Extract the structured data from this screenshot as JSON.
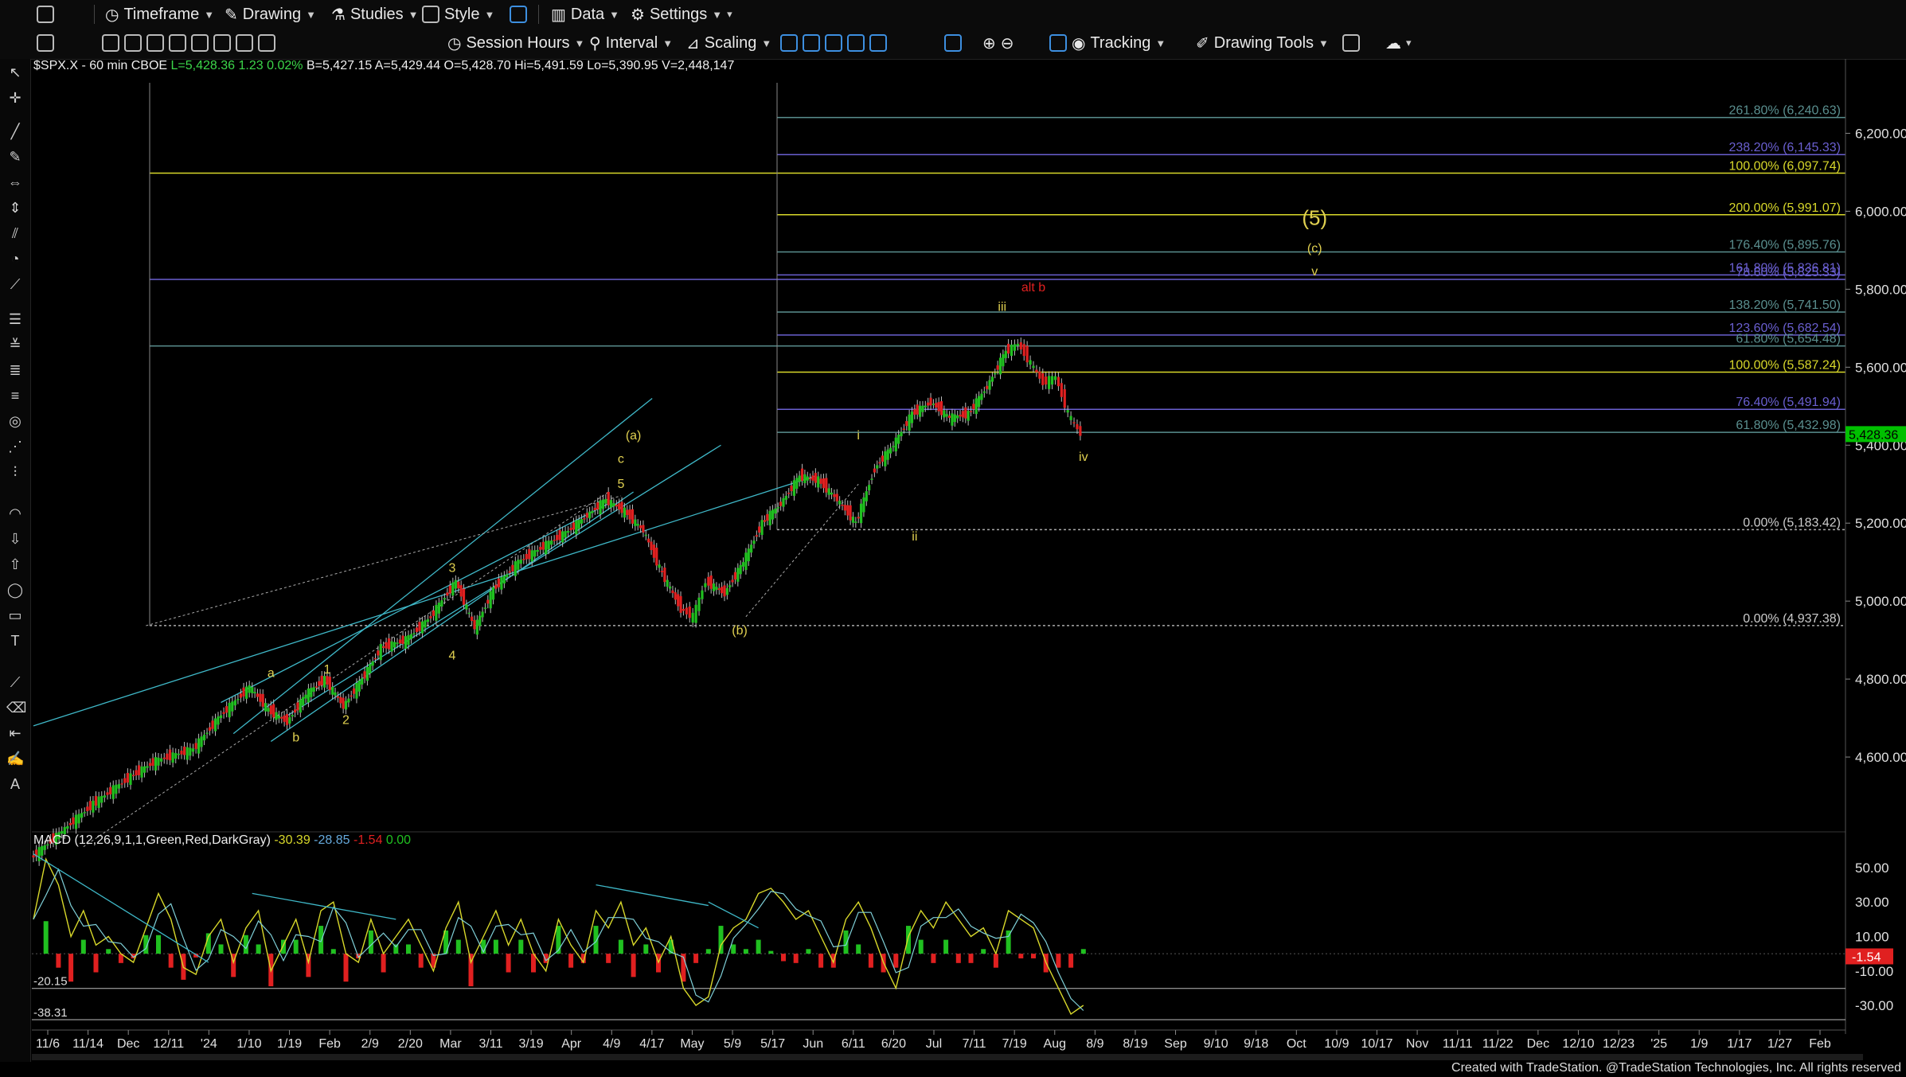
{
  "toolbar1": {
    "items": [
      {
        "name": "timeframe-menu",
        "label": "Timeframe",
        "icon": "clock-icon"
      },
      {
        "name": "drawing-menu",
        "label": "Drawing",
        "icon": "pencil-icon"
      },
      {
        "name": "studies-menu",
        "label": "Studies",
        "icon": "flask-icon"
      },
      {
        "name": "style-menu",
        "label": "Style",
        "icon": "style-icon"
      },
      {
        "name": "data-menu",
        "label": "Data",
        "icon": "bars-icon"
      },
      {
        "name": "settings-menu",
        "label": "Settings",
        "icon": "gear-icon"
      }
    ]
  },
  "toolbar2": {
    "session_hours": "Session Hours",
    "interval": "Interval",
    "scaling": "Scaling",
    "tracking": "Tracking",
    "drawing_tools": "Drawing Tools"
  },
  "symbol_header": {
    "symbol": "$SPX.X - 60 min",
    "exchange": "CBOE",
    "last": "L=5,428.36",
    "change": "1.23",
    "pct": "0.02%",
    "bid": "B=5,427.15",
    "ask": "A=5,429.44",
    "open": "O=5,428.70",
    "high": "Hi=5,491.59",
    "low": "Lo=5,390.95",
    "volume": "V=2,448,147"
  },
  "macd_header": {
    "label": "MACD (12,26,9,1,1,Green,Red,DarkGray)",
    "v1": "-30.39",
    "v2": "-28.85",
    "v3": "-1.54",
    "v4": "0.00"
  },
  "footer": "Created with TradeStation. @TradeStation Technologies, Inc. All rights reserved",
  "colors": {
    "up": "#20c020",
    "down": "#e02020",
    "yellow_level": "#d8d82a",
    "blue_level": "#6a5fd0",
    "teal_level": "#5a8f8f",
    "price_tag": "#00c000",
    "wave_label": "#e0d050",
    "alt_label": "#e02020"
  },
  "chart_data": [
    {
      "type": "candlestick",
      "title": "$SPX.X - 60 min",
      "ylim": [
        4400,
        6350
      ],
      "y_ticks": [
        "6,200.00",
        "6,000.00",
        "5,800.00",
        "5,600.00",
        "5,400.00",
        "5,200.00",
        "5,000.00",
        "4,800.00",
        "4,600.00"
      ],
      "y_tick_values": [
        6200,
        6000,
        5800,
        5600,
        5400,
        5200,
        5000,
        4800,
        4600
      ],
      "x_ticks": [
        "11/6",
        "11/14",
        "Dec",
        "12/11",
        "'24",
        "1/10",
        "1/19",
        "Feb",
        "2/9",
        "2/20",
        "Mar",
        "3/11",
        "3/19",
        "Apr",
        "4/9",
        "4/17",
        "May",
        "5/9",
        "5/17",
        "Jun",
        "6/11",
        "6/20",
        "Jul",
        "7/11",
        "7/19",
        "Aug",
        "8/9",
        "8/19",
        "Sep",
        "9/10",
        "9/18",
        "Oct",
        "10/9",
        "10/17",
        "Nov",
        "11/11",
        "11/22",
        "Dec",
        "12/10",
        "12/23",
        "'25",
        "1/9",
        "1/17",
        "1/27",
        "Feb"
      ],
      "last_price": "5,428.36",
      "price_path": [
        [
          0,
          4340
        ],
        [
          5,
          4410
        ],
        [
          10,
          4480
        ],
        [
          16,
          4550
        ],
        [
          20,
          4590
        ],
        [
          26,
          4620
        ],
        [
          30,
          4700
        ],
        [
          35,
          4780
        ],
        [
          38,
          4720
        ],
        [
          41,
          4690
        ],
        [
          44,
          4760
        ],
        [
          47,
          4800
        ],
        [
          50,
          4730
        ],
        [
          53,
          4800
        ],
        [
          56,
          4880
        ],
        [
          60,
          4900
        ],
        [
          64,
          4960
        ],
        [
          68,
          5050
        ],
        [
          71,
          4930
        ],
        [
          74,
          5030
        ],
        [
          78,
          5100
        ],
        [
          82,
          5140
        ],
        [
          86,
          5180
        ],
        [
          89,
          5220
        ],
        [
          92,
          5260
        ],
        [
          95,
          5230
        ],
        [
          98,
          5180
        ],
        [
          101,
          5070
        ],
        [
          104,
          4980
        ],
        [
          106,
          4960
        ],
        [
          108,
          5050
        ],
        [
          111,
          5020
        ],
        [
          114,
          5100
        ],
        [
          117,
          5200
        ],
        [
          120,
          5250
        ],
        [
          123,
          5320
        ],
        [
          126,
          5310
        ],
        [
          129,
          5260
        ],
        [
          132,
          5200
        ],
        [
          135,
          5340
        ],
        [
          138,
          5400
        ],
        [
          141,
          5480
        ],
        [
          144,
          5510
        ],
        [
          147,
          5470
        ],
        [
          150,
          5480
        ],
        [
          153,
          5550
        ],
        [
          156,
          5640
        ],
        [
          158,
          5660
        ],
        [
          160,
          5610
        ],
        [
          162,
          5560
        ],
        [
          164,
          5575
        ],
        [
          166,
          5480
        ],
        [
          168,
          5428
        ]
      ],
      "fib_levels": [
        {
          "label": "261.80% (6,240.63)",
          "value": 6240.63,
          "color": "teal"
        },
        {
          "label": "238.20% (6,145.33)",
          "value": 6145.33,
          "color": "blue"
        },
        {
          "label": "100.00% (6,097.74)",
          "value": 6097.74,
          "color": "yellow"
        },
        {
          "label": "200.00% (5,991.07)",
          "value": 5991.07,
          "color": "yellow"
        },
        {
          "label": "176.40% (5,895.76)",
          "value": 5895.76,
          "color": "teal"
        },
        {
          "label": "161.80% (5,836.81)",
          "value": 5836.81,
          "color": "blue"
        },
        {
          "label": "78.60% (5,825.33)",
          "value": 5825.33,
          "color": "blue"
        },
        {
          "label": "138.20% (5,741.50)",
          "value": 5741.5,
          "color": "teal"
        },
        {
          "label": "123.60% (5,682.54)",
          "value": 5682.54,
          "color": "blue"
        },
        {
          "label": "61.80% (5,654.48)",
          "value": 5654.48,
          "color": "teal"
        },
        {
          "label": "100.00% (5,587.24)",
          "value": 5587.24,
          "color": "yellow"
        },
        {
          "label": "76.40% (5,491.94)",
          "value": 5491.94,
          "color": "blue"
        },
        {
          "label": "61.80% (5,432.98)",
          "value": 5432.98,
          "color": "teal"
        },
        {
          "label": "0.00% (5,183.42)",
          "value": 5183.42,
          "color": "white"
        },
        {
          "label": "0.00% (4,937.38)",
          "value": 4937.38,
          "color": "white"
        }
      ],
      "wave_labels": [
        {
          "text": "(5)",
          "x": 205,
          "y": 5965,
          "color": "yellow",
          "big": true
        },
        {
          "text": "(c)",
          "x": 205,
          "y": 5895,
          "color": "yellow"
        },
        {
          "text": "v",
          "x": 205,
          "y": 5835,
          "color": "yellow"
        },
        {
          "text": "alt b",
          "x": 160,
          "y": 5795,
          "color": "red"
        },
        {
          "text": "iii",
          "x": 155,
          "y": 5745,
          "color": "yellow"
        },
        {
          "text": "i",
          "x": 132,
          "y": 5415,
          "color": "yellow"
        },
        {
          "text": "ii",
          "x": 141,
          "y": 5155,
          "color": "yellow"
        },
        {
          "text": "iv",
          "x": 168,
          "y": 5360,
          "color": "yellow"
        },
        {
          "text": "(a)",
          "x": 96,
          "y": 5415,
          "color": "yellow"
        },
        {
          "text": "c",
          "x": 94,
          "y": 5355,
          "color": "yellow"
        },
        {
          "text": "5",
          "x": 94,
          "y": 5290,
          "color": "yellow"
        },
        {
          "text": "(b)",
          "x": 113,
          "y": 4915,
          "color": "yellow"
        },
        {
          "text": "3",
          "x": 67,
          "y": 5075,
          "color": "yellow"
        },
        {
          "text": "4",
          "x": 67,
          "y": 4850,
          "color": "yellow"
        },
        {
          "text": "1",
          "x": 47,
          "y": 4815,
          "color": "yellow"
        },
        {
          "text": "2",
          "x": 50,
          "y": 4685,
          "color": "yellow"
        },
        {
          "text": "a",
          "x": 38,
          "y": 4805,
          "color": "yellow"
        },
        {
          "text": "b",
          "x": 42,
          "y": 4640,
          "color": "yellow"
        }
      ]
    },
    {
      "type": "macd",
      "title": "MACD (12,26,9,1,1,Green,Red,DarkGray)",
      "ylim": [
        -42,
        62
      ],
      "y_ticks": [
        "50.00",
        "30.00",
        "10.00",
        "-10.00",
        "-30.00"
      ],
      "y_tick_values": [
        50,
        30,
        10,
        -10,
        -30
      ],
      "level_labels": [
        "-20.15",
        "-38.31"
      ],
      "level_values": [
        -20.15,
        -38.31
      ],
      "last_value": "-1.54",
      "macd_path": [
        [
          0,
          20
        ],
        [
          2,
          55
        ],
        [
          4,
          40
        ],
        [
          6,
          10
        ],
        [
          8,
          25
        ],
        [
          10,
          5
        ],
        [
          12,
          10
        ],
        [
          14,
          0
        ],
        [
          16,
          -5
        ],
        [
          18,
          15
        ],
        [
          20,
          35
        ],
        [
          22,
          20
        ],
        [
          24,
          -8
        ],
        [
          26,
          -12
        ],
        [
          28,
          10
        ],
        [
          30,
          20
        ],
        [
          32,
          -5
        ],
        [
          34,
          15
        ],
        [
          36,
          25
        ],
        [
          38,
          -10
        ],
        [
          40,
          5
        ],
        [
          42,
          20
        ],
        [
          44,
          -5
        ],
        [
          46,
          25
        ],
        [
          48,
          30
        ],
        [
          50,
          0
        ],
        [
          52,
          -5
        ],
        [
          54,
          20
        ],
        [
          56,
          0
        ],
        [
          58,
          10
        ],
        [
          60,
          20
        ],
        [
          62,
          5
        ],
        [
          64,
          -10
        ],
        [
          66,
          15
        ],
        [
          68,
          30
        ],
        [
          70,
          -5
        ],
        [
          72,
          10
        ],
        [
          74,
          25
        ],
        [
          76,
          5
        ],
        [
          78,
          20
        ],
        [
          80,
          0
        ],
        [
          82,
          -10
        ],
        [
          84,
          20
        ],
        [
          86,
          5
        ],
        [
          88,
          -5
        ],
        [
          90,
          25
        ],
        [
          92,
          15
        ],
        [
          94,
          30
        ],
        [
          96,
          5
        ],
        [
          98,
          15
        ],
        [
          100,
          -5
        ],
        [
          102,
          10
        ],
        [
          104,
          -20
        ],
        [
          106,
          -30
        ],
        [
          108,
          -25
        ],
        [
          110,
          5
        ],
        [
          112,
          15
        ],
        [
          114,
          20
        ],
        [
          116,
          35
        ],
        [
          118,
          38
        ],
        [
          120,
          30
        ],
        [
          122,
          20
        ],
        [
          124,
          25
        ],
        [
          126,
          10
        ],
        [
          128,
          -5
        ],
        [
          130,
          20
        ],
        [
          132,
          30
        ],
        [
          134,
          15
        ],
        [
          136,
          -5
        ],
        [
          138,
          -20
        ],
        [
          140,
          10
        ],
        [
          142,
          25
        ],
        [
          144,
          15
        ],
        [
          146,
          30
        ],
        [
          148,
          20
        ],
        [
          150,
          10
        ],
        [
          152,
          15
        ],
        [
          154,
          0
        ],
        [
          156,
          25
        ],
        [
          158,
          20
        ],
        [
          160,
          15
        ],
        [
          162,
          -5
        ],
        [
          164,
          -20
        ],
        [
          166,
          -35
        ],
        [
          168,
          -30
        ]
      ]
    }
  ]
}
